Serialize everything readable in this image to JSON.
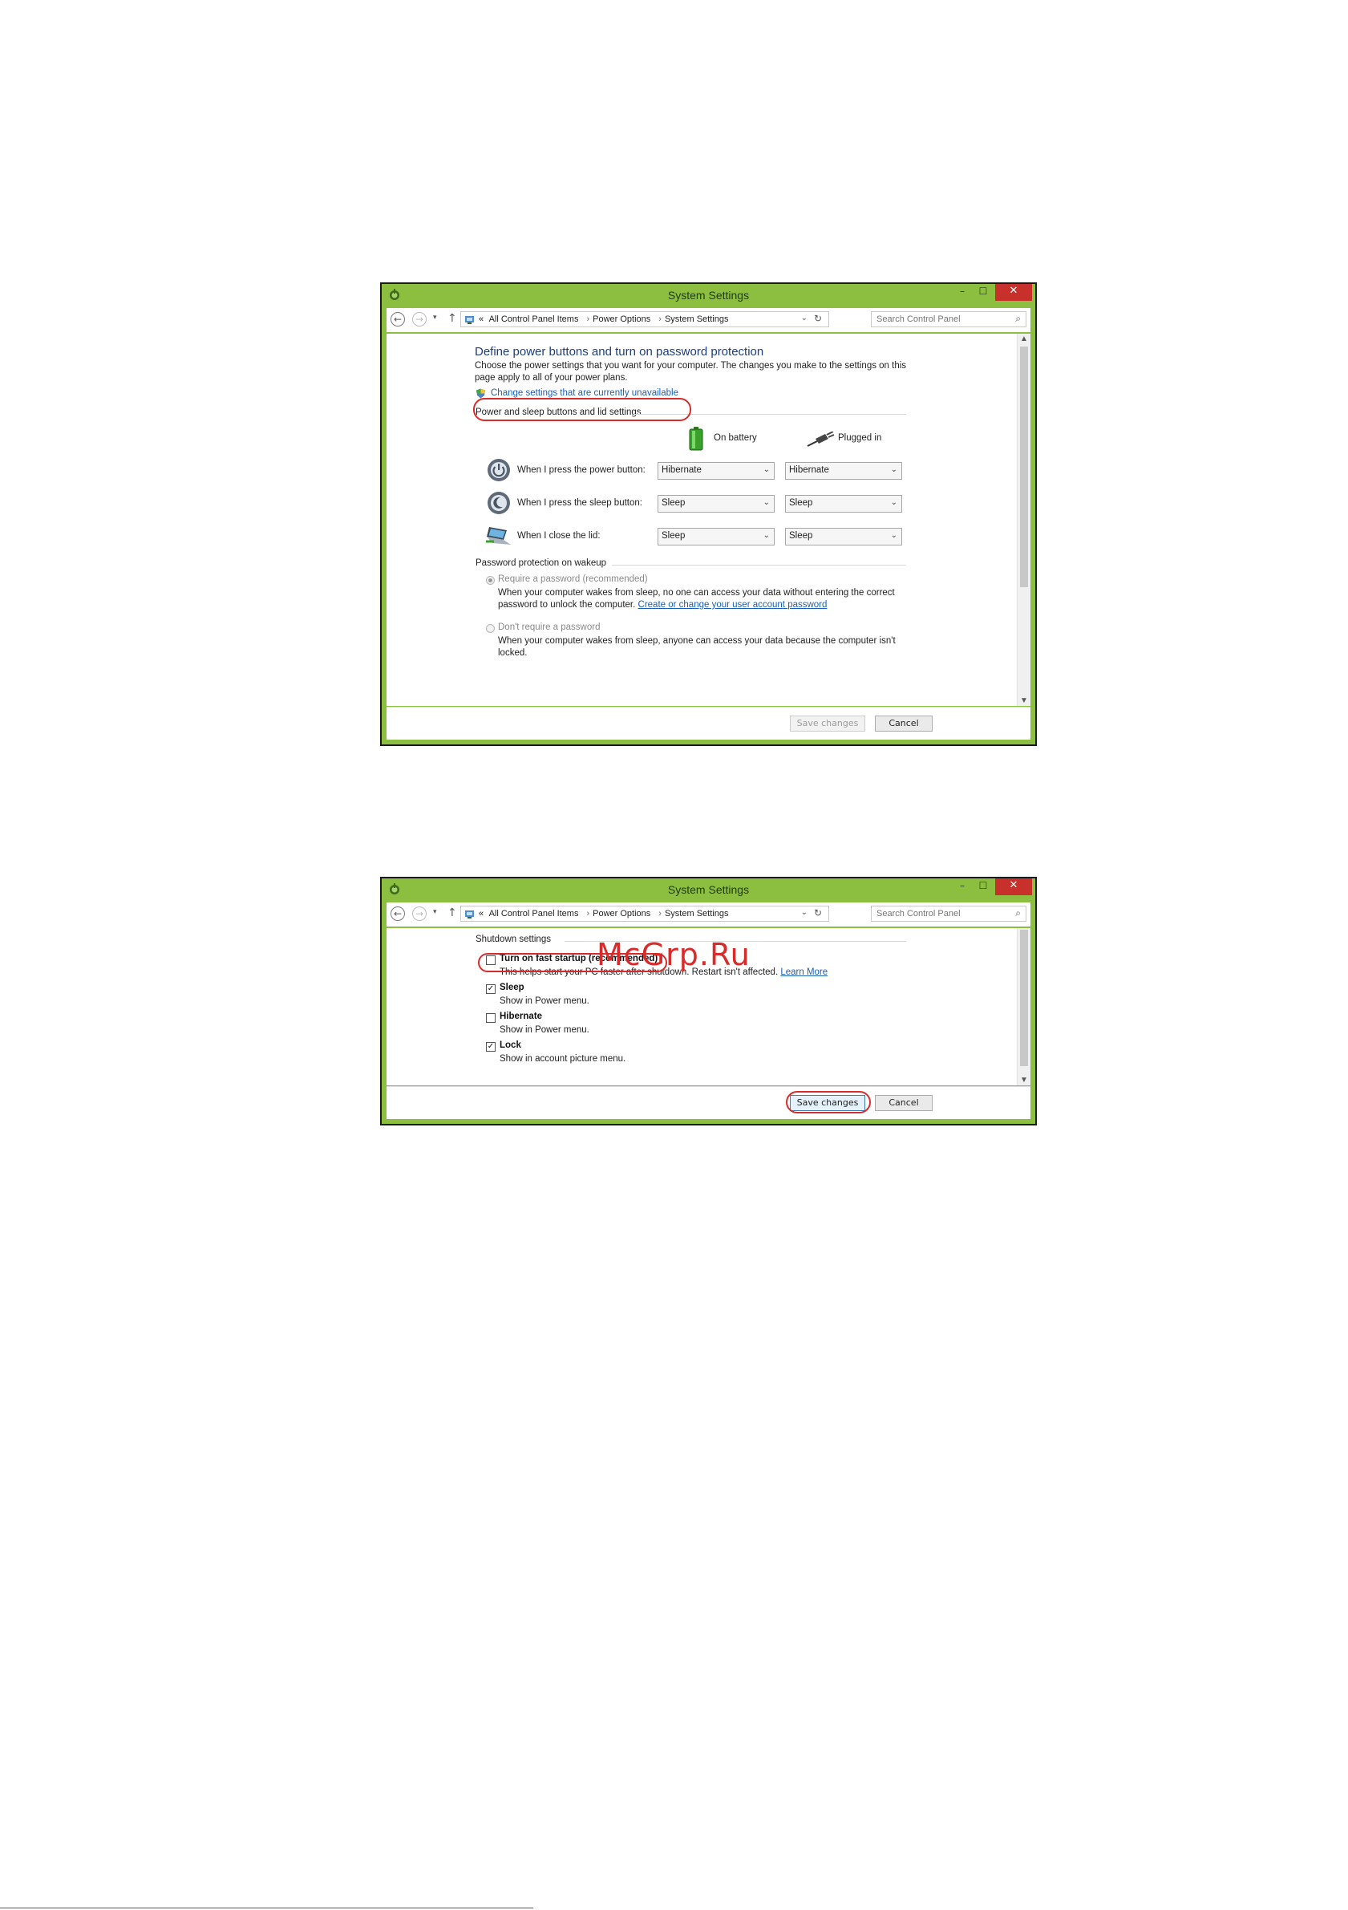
{
  "window_title": "System Settings",
  "window_controls": {
    "minimize": "–",
    "maximize": "☐",
    "close": "✕"
  },
  "navigation": {
    "back": "←",
    "forward": "→",
    "recent": "▾",
    "up": "↑",
    "breadcrumb_prefix": "«",
    "breadcrumbs": [
      "All Control Panel Items",
      "Power Options",
      "System Settings"
    ],
    "separator": "›",
    "dropdown": "⌄",
    "refresh": "↻",
    "search_placeholder": "Search Control Panel",
    "search_icon": "⌕"
  },
  "screen1": {
    "heading": "Define power buttons and turn on password protection",
    "description_line1": "Choose the power settings that you want for your computer. The changes you make to the settings on this",
    "description_line2": "page apply to all of your power plans.",
    "change_settings_link": "Change settings that are currently unavailable",
    "buttons_group_label": "Power and sleep buttons and lid settings",
    "col_on_battery": "On battery",
    "col_plugged_in": "Plugged in",
    "rows": [
      {
        "label": "When I press the power button:",
        "battery": "Hibernate",
        "plugged": "Hibernate"
      },
      {
        "label": "When I press the sleep button:",
        "battery": "Sleep",
        "plugged": "Sleep"
      },
      {
        "label": "When I close the lid:",
        "battery": "Sleep",
        "plugged": "Sleep"
      }
    ],
    "password_group_label": "Password protection on wakeup",
    "require_password": "Require a password (recommended)",
    "require_desc_line1": "When your computer wakes from sleep, no one can access your data without entering the correct",
    "require_desc_line2_prefix": "password to unlock the computer.",
    "require_desc_link": "Create or change your user account password",
    "dont_require": "Don't require a password",
    "dont_desc_line1": "When your computer wakes from sleep, anyone can access your data because the computer isn't",
    "dont_desc_line2": "locked.",
    "save_label": "Save changes",
    "cancel_label": "Cancel"
  },
  "screen2": {
    "group_label": "Shutdown settings",
    "items": [
      {
        "label": "Turn on fast startup (recommended)",
        "checked": false,
        "desc": "This helps start your PC faster after shutdown. Restart isn't affected.",
        "link": "Learn More"
      },
      {
        "label": "Sleep",
        "checked": true,
        "desc": "Show in Power menu.",
        "link": ""
      },
      {
        "label": "Hibernate",
        "checked": false,
        "desc": "Show in Power menu.",
        "link": ""
      },
      {
        "label": "Lock",
        "checked": true,
        "desc": "Show in account picture menu.",
        "link": ""
      }
    ],
    "check_mark": "✓",
    "save_label": "Save changes",
    "cancel_label": "Cancel"
  },
  "watermark": "McGrp.Ru",
  "colors": {
    "window_frame": "#8cbf3f",
    "close_button": "#c7302b",
    "highlight_oval": "#d92b2b",
    "heading": "#1e3e7b",
    "link": "#1a5fb4"
  }
}
